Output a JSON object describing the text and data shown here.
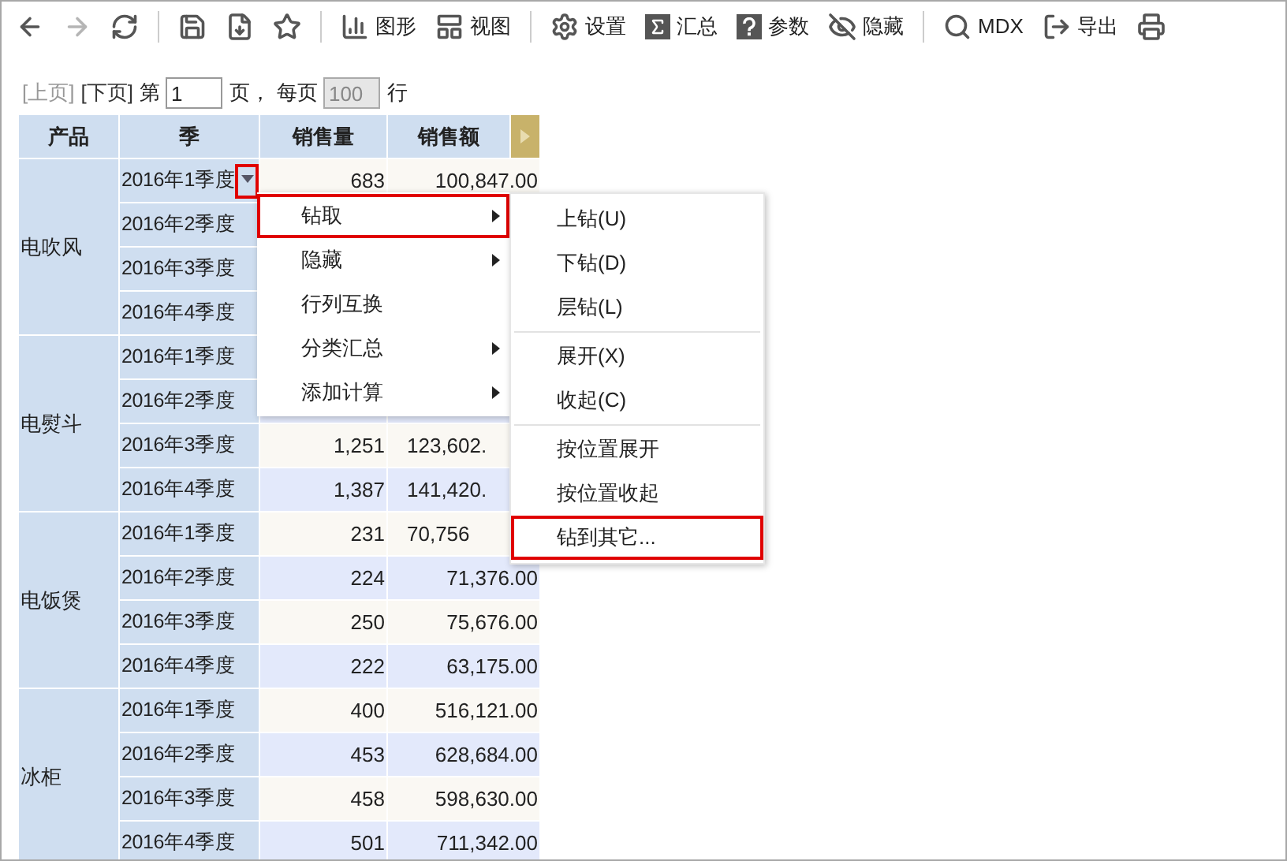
{
  "toolbar": [
    {
      "kind": "button",
      "disabled": false
    },
    {
      "kind": "button",
      "disabled": true
    },
    {
      "kind": "button",
      "disabled": false
    },
    {
      "kind": "separator"
    },
    {
      "kind": "button",
      "disabled": false
    },
    {
      "kind": "button",
      "disabled": false
    },
    {
      "kind": "button",
      "disabled": false
    },
    {
      "kind": "separator"
    },
    {
      "kind": "button",
      "label": "图形",
      "disabled": false
    },
    {
      "kind": "button",
      "label": "视图",
      "disabled": false
    },
    {
      "kind": "separator"
    },
    {
      "kind": "button",
      "label": "设置",
      "disabled": false
    },
    {
      "kind": "button",
      "label": "汇总",
      "disabled": false
    },
    {
      "kind": "button",
      "label": "参数",
      "disabled": false
    },
    {
      "kind": "button",
      "label": "隐藏",
      "disabled": false
    },
    {
      "kind": "separator"
    },
    {
      "kind": "button",
      "label": "MDX",
      "disabled": false
    },
    {
      "kind": "button",
      "label": "导出",
      "disabled": false
    },
    {
      "kind": "button",
      "disabled": false
    }
  ],
  "pager": {
    "prev": {
      "label": "[上页]",
      "disabled": true
    },
    "next": {
      "label": "[下页]",
      "disabled": false
    },
    "page_prefix": "第",
    "page_value": "1",
    "page_suffix": "页，",
    "size_prefix": "每页",
    "size_value": "100",
    "size_disabled": true,
    "size_suffix": "行"
  },
  "table": {
    "columns": [
      "产品",
      "季",
      "销售量",
      "销售额"
    ],
    "groups": [
      {
        "product": "电吹风",
        "rows": [
          {
            "quarter": "2016年1季度",
            "quantity": "683",
            "amount": "100,847.00",
            "dropdown_highlighted": true
          },
          {
            "quarter": "2016年2季度"
          },
          {
            "quarter": "2016年3季度"
          },
          {
            "quarter": "2016年4季度"
          }
        ]
      },
      {
        "product": "电熨斗",
        "rows": [
          {
            "quarter": "2016年1季度"
          },
          {
            "quarter": "2016年2季度"
          },
          {
            "quarter": "2016年3季度",
            "quantity": "1,251",
            "amount": "123,602."
          },
          {
            "quarter": "2016年4季度",
            "quantity": "1,387",
            "amount": "141,420."
          }
        ]
      },
      {
        "product": "电饭煲",
        "rows": [
          {
            "quarter": "2016年1季度",
            "quantity": "231",
            "amount": "70,756"
          },
          {
            "quarter": "2016年2季度",
            "quantity": "224",
            "amount": "71,376.00"
          },
          {
            "quarter": "2016年3季度",
            "quantity": "250",
            "amount": "75,676.00"
          },
          {
            "quarter": "2016年4季度",
            "quantity": "222",
            "amount": "63,175.00"
          }
        ]
      },
      {
        "product": "冰柜",
        "rows": [
          {
            "quarter": "2016年1季度",
            "quantity": "400",
            "amount": "516,121.00"
          },
          {
            "quarter": "2016年2季度",
            "quantity": "453",
            "amount": "628,684.00"
          },
          {
            "quarter": "2016年3季度",
            "quantity": "458",
            "amount": "598,630.00"
          },
          {
            "quarter": "2016年4季度",
            "quantity": "501",
            "amount": "711,342.00"
          }
        ]
      }
    ]
  },
  "context_menu": [
    {
      "label": "钻取",
      "submenu": true,
      "highlighted": true
    },
    {
      "label": "隐藏",
      "submenu": true,
      "highlighted": false
    },
    {
      "label": "行列互换",
      "submenu": false,
      "highlighted": false
    },
    {
      "label": "分类汇总",
      "submenu": true,
      "highlighted": false
    },
    {
      "label": "添加计算",
      "submenu": true,
      "highlighted": false
    }
  ],
  "submenu": [
    {
      "kind": "item",
      "label": "上钻(U)",
      "highlighted": false
    },
    {
      "kind": "item",
      "label": "下钻(D)",
      "highlighted": false
    },
    {
      "kind": "item",
      "label": "层钻(L)",
      "highlighted": false
    },
    {
      "kind": "separator"
    },
    {
      "kind": "item",
      "label": "展开(X)",
      "highlighted": false
    },
    {
      "kind": "item",
      "label": "收起(C)",
      "highlighted": false
    },
    {
      "kind": "separator"
    },
    {
      "kind": "item",
      "label": "按位置展开",
      "highlighted": false
    },
    {
      "kind": "item",
      "label": "按位置收起",
      "highlighted": false
    },
    {
      "kind": "item",
      "label": "钻到其它...",
      "highlighted": true
    }
  ]
}
